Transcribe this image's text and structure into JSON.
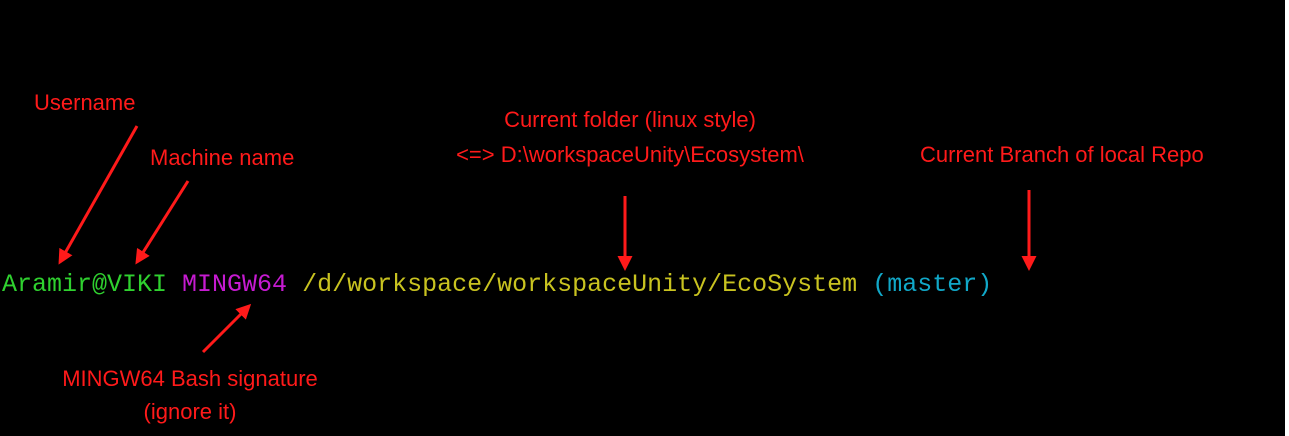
{
  "colors": {
    "background": "#000000",
    "annotation": "#ff1a1a",
    "user_host": "#2fd12f",
    "mingw": "#c61bd1",
    "path": "#c9c320",
    "branch": "#11a8c8"
  },
  "prompt": {
    "user_host": "Aramir@VIKI",
    "mingw": "MINGW64",
    "path": "/d/workspace/workspaceUnity/EcoSystem",
    "branch": "(master)"
  },
  "annotations": {
    "username": "Username",
    "machine_name": "Machine name",
    "current_folder_line1": "Current folder (linux style)",
    "current_folder_line2": "<=> D:\\workspaceUnity\\Ecosystem\\",
    "current_branch": "Current Branch of local Repo",
    "mingw_line1": "MINGW64 Bash signature",
    "mingw_line2": "(ignore it)"
  }
}
